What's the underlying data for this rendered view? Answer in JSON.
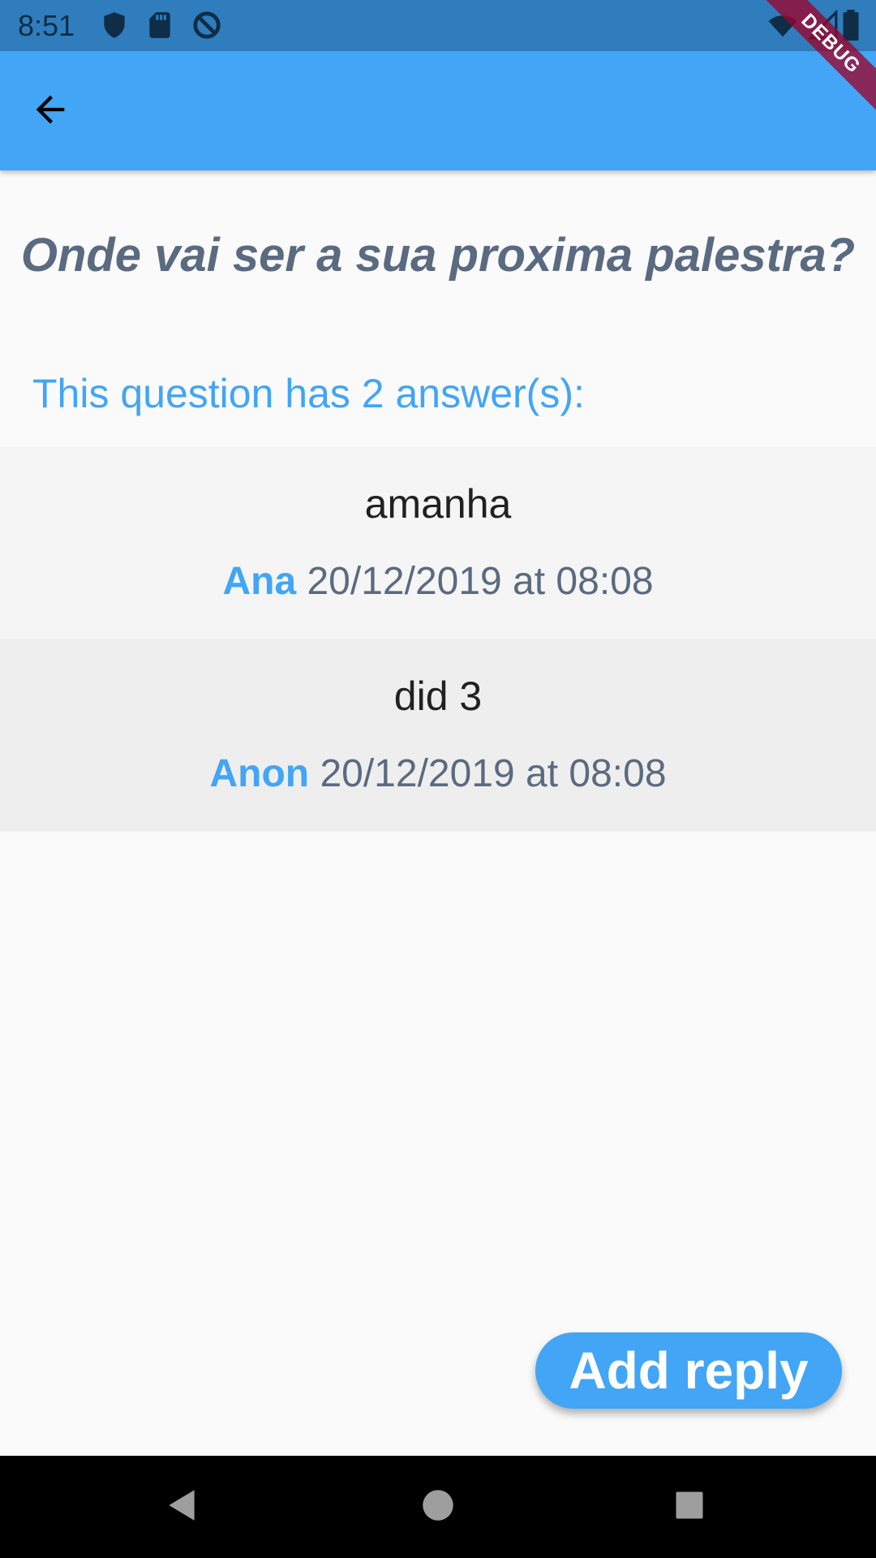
{
  "status_bar": {
    "time": "8:51",
    "icons": [
      "shield-icon",
      "sd-card-icon",
      "do-not-disturb-icon",
      "wifi-icon",
      "cell-signal-icon",
      "battery-icon"
    ]
  },
  "app_bar": {
    "back_icon": "arrow-back-icon",
    "color": "#42a5f5"
  },
  "debug_banner": {
    "label": "DEBUG"
  },
  "question": {
    "title": "Onde vai ser a sua proxima palestra?",
    "answers_summary": "This question has 2 answer(s):"
  },
  "answers": [
    {
      "text": "amanha",
      "author": "Ana",
      "timestamp": "20/12/2019 at 08:08"
    },
    {
      "text": "did 3",
      "author": "Anon",
      "timestamp": "20/12/2019 at 08:08"
    }
  ],
  "fab": {
    "label": "Add reply"
  },
  "nav_bar": {
    "buttons": [
      "back-triangle-icon",
      "home-circle-icon",
      "recents-square-icon"
    ]
  },
  "colors": {
    "accent": "#42a5f5",
    "status_bar": "#2f7dbd",
    "title_text": "#5a6a80"
  }
}
